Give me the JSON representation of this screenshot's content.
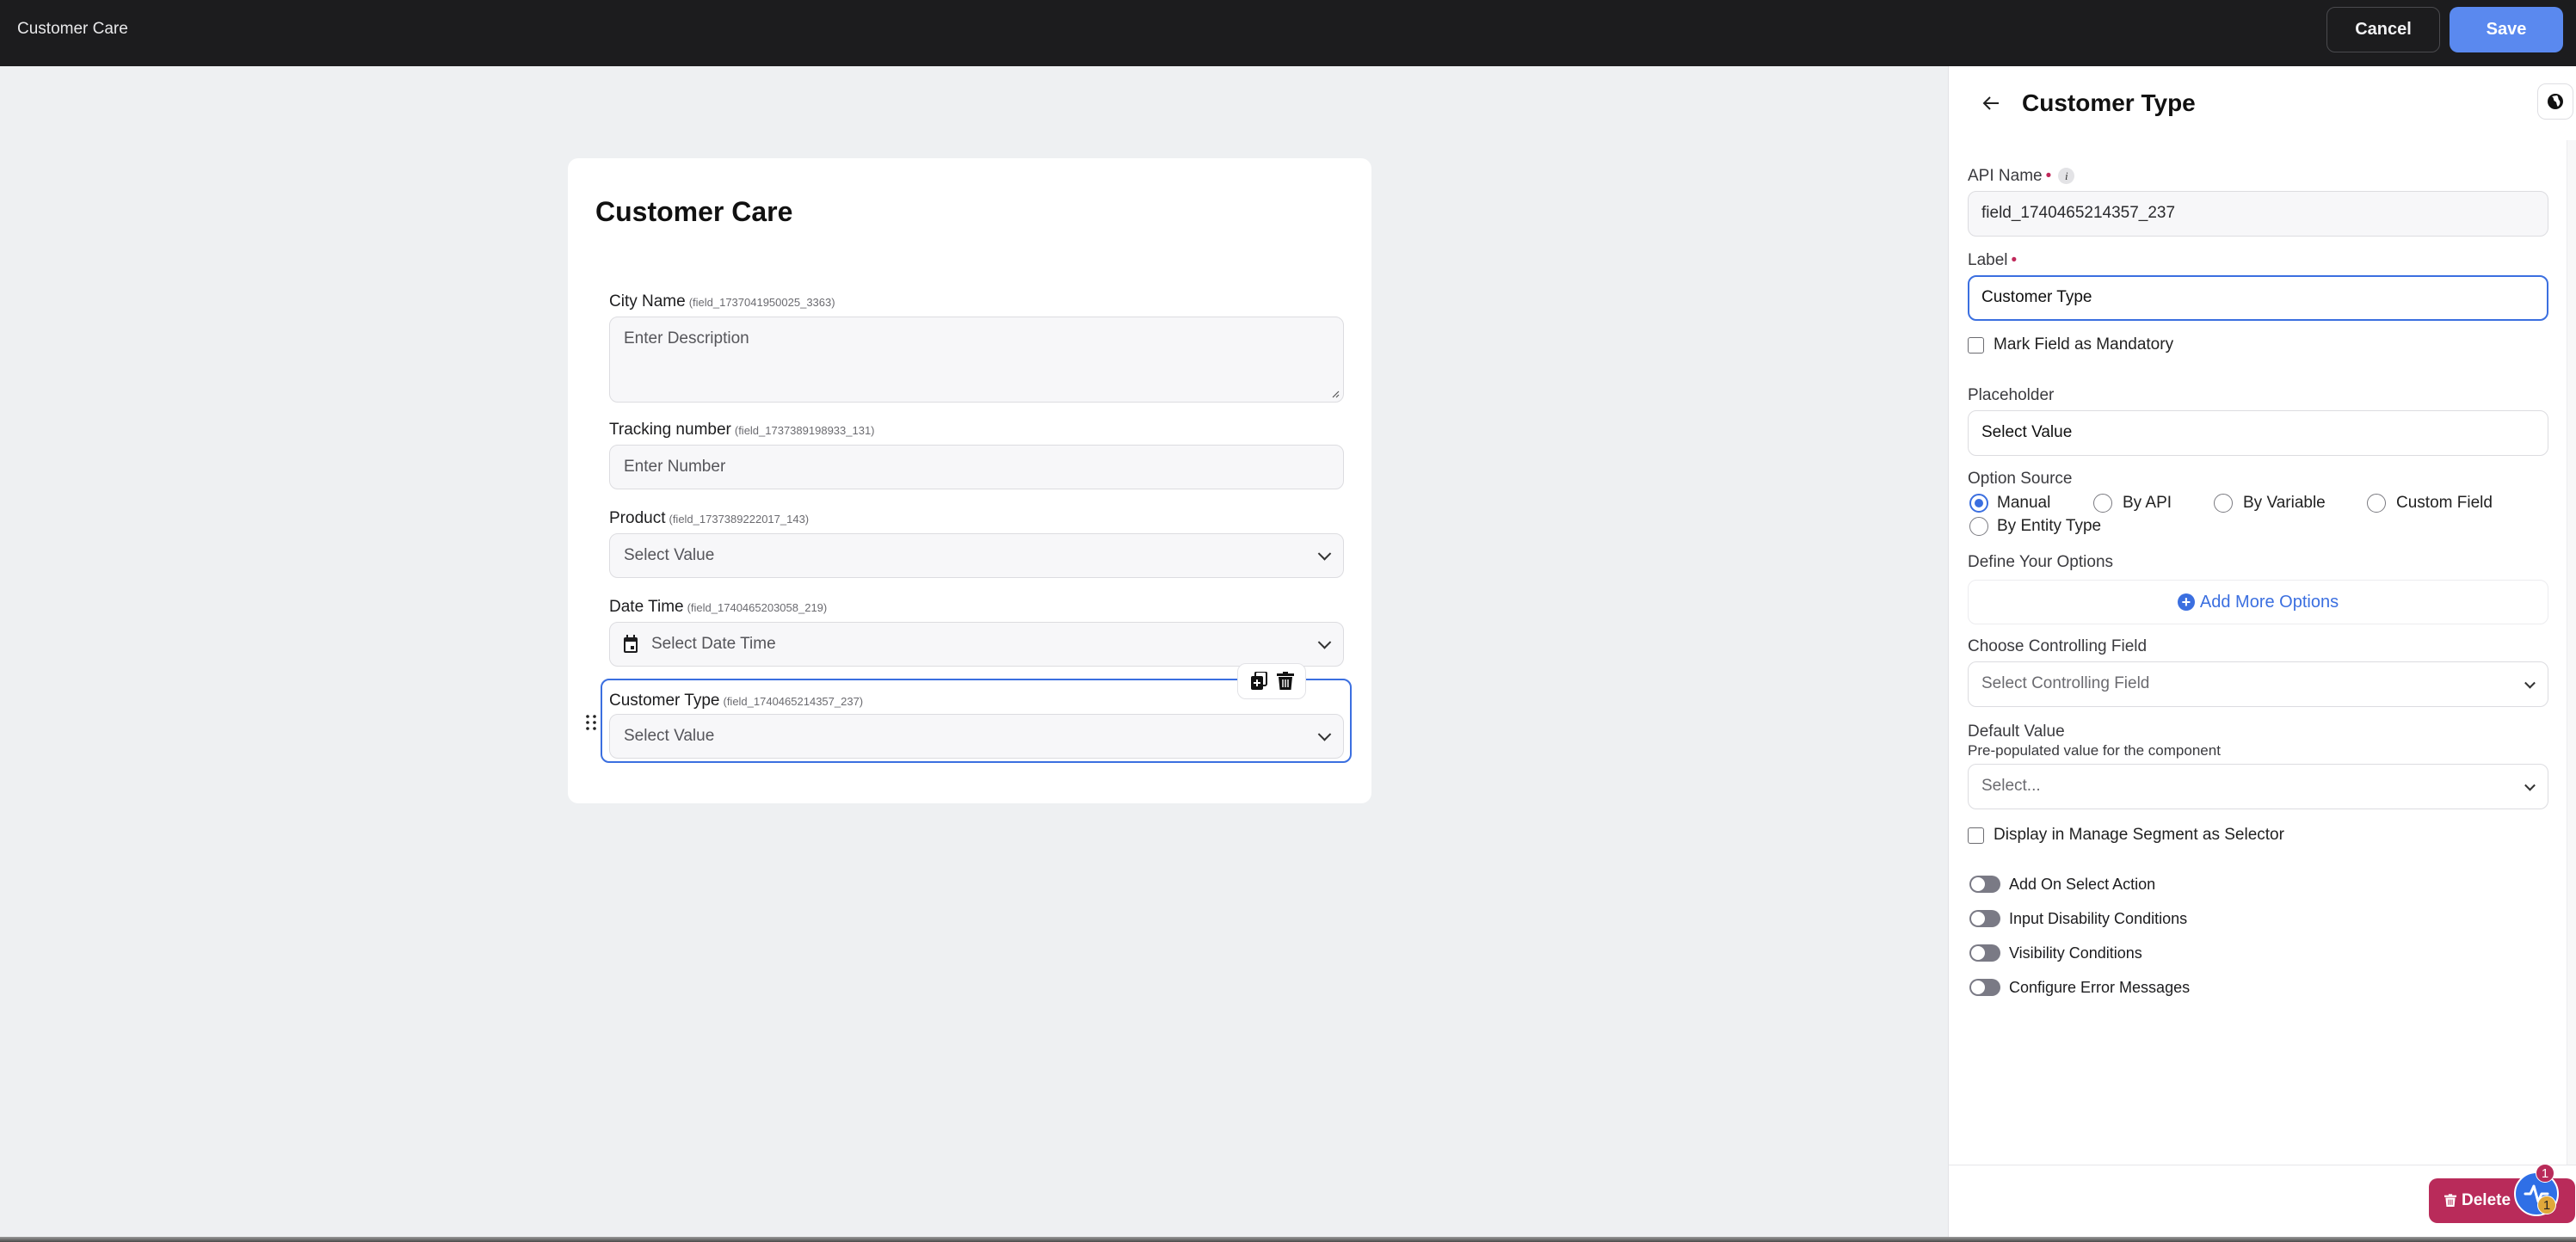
{
  "topbar": {
    "title": "Customer Care",
    "cancel_label": "Cancel",
    "save_label": "Save"
  },
  "form": {
    "title": "Customer Care",
    "fields": [
      {
        "label": "City Name",
        "api": "(field_1737041950025_3363)",
        "placeholder": "Enter Description",
        "type": "textarea"
      },
      {
        "label": "Tracking number",
        "api": "(field_1737389198933_131)",
        "placeholder": "Enter Number",
        "type": "number"
      },
      {
        "label": "Product",
        "api": "(field_1737389222017_143)",
        "placeholder": "Select Value",
        "type": "select"
      },
      {
        "label": "Date Time",
        "api": "(field_1740465203058_219)",
        "placeholder": "Select Date Time",
        "type": "datetime"
      },
      {
        "label": "Customer Type",
        "api": "(field_1740465214357_237)",
        "placeholder": "Select Value",
        "type": "select",
        "selected": true
      }
    ],
    "field_toolbar": {
      "duplicate_icon": "copy-plus-icon",
      "delete_icon": "trash-icon"
    }
  },
  "panel": {
    "title": "Customer Type",
    "back_icon": "arrow-left-icon",
    "globe_icon": "globe-icon",
    "api_name_label": "API Name",
    "api_name_value": "field_1740465214357_237",
    "label_label": "Label",
    "label_value": "Customer Type",
    "mandatory_label": "Mark Field as Mandatory",
    "mandatory_checked": false,
    "placeholder_label": "Placeholder",
    "placeholder_value": "Select Value",
    "option_source_label": "Option Source",
    "option_source_options": [
      "Manual",
      "By API",
      "By Variable",
      "Custom Field",
      "By Entity Type"
    ],
    "option_source_selected": "Manual",
    "define_options_label": "Define Your Options",
    "add_more_options_label": "Add More Options",
    "controlling_field_label": "Choose Controlling Field",
    "controlling_field_placeholder": "Select Controlling Field",
    "default_value_label": "Default Value",
    "default_value_hint": "Pre-populated value for the component",
    "default_value_placeholder": "Select...",
    "manage_segment_label": "Display in Manage Segment as Selector",
    "manage_segment_checked": false,
    "toggles": [
      {
        "label": "Add On Select Action",
        "on": false
      },
      {
        "label": "Input Disability Conditions",
        "on": false
      },
      {
        "label": "Visibility Conditions",
        "on": false
      },
      {
        "label": "Configure Error Messages",
        "on": false
      }
    ],
    "delete_label": "Delete"
  },
  "fab": {
    "icon": "activity-icon",
    "badge_top": "1",
    "badge_bottom": "1"
  },
  "colors": {
    "accent": "#3b6fe0",
    "save": "#5a89ef",
    "danger": "#b92b5a",
    "topbar": "#1c1c1e"
  }
}
